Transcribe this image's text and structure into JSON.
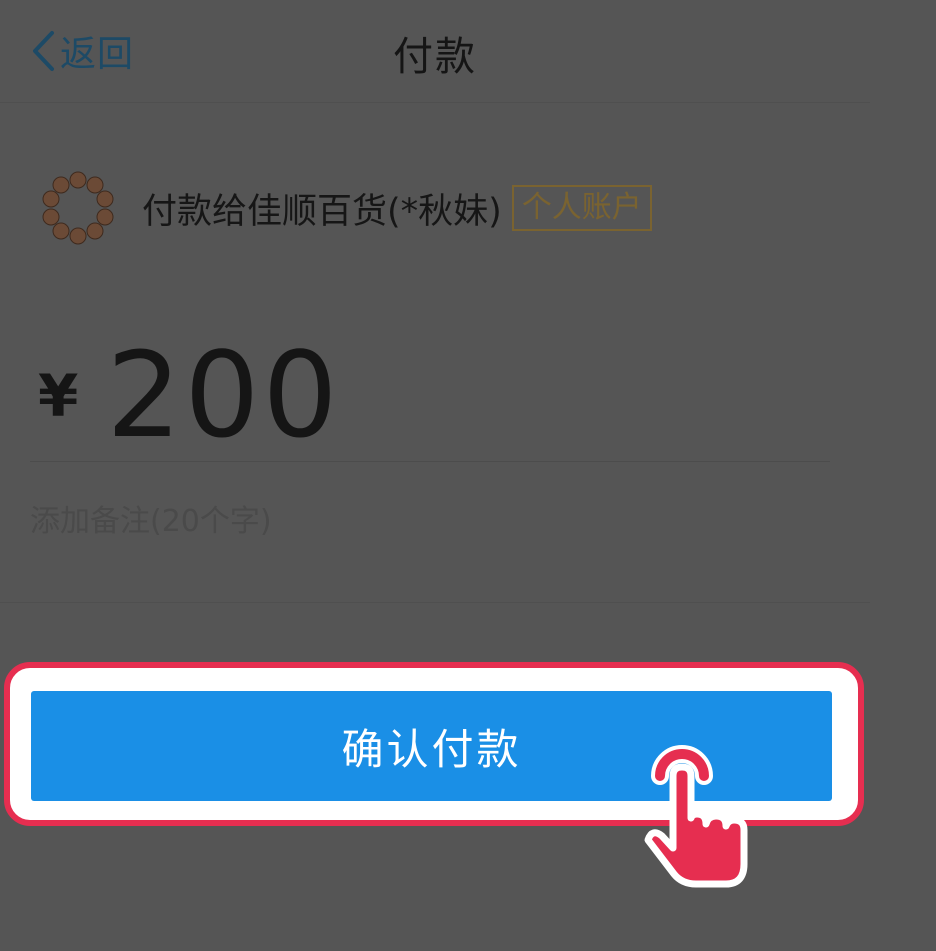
{
  "header": {
    "back_label": "返回",
    "title": "付款"
  },
  "payee": {
    "name": "付款给佳顺百货(*秋妹)",
    "account_badge": "个人账户"
  },
  "amount": {
    "currency": "¥",
    "value": "200"
  },
  "remark": {
    "placeholder": "添加备注(20个字)"
  },
  "actions": {
    "confirm_label": "确认付款"
  },
  "icons": {
    "back": "chevron-left-icon",
    "avatar": "bead-bracelet-avatar",
    "tap_hint": "tap-hand-icon"
  },
  "colors": {
    "button": "#1a8fe6",
    "highlight": "#e62e50",
    "badge": "#7a6330"
  }
}
